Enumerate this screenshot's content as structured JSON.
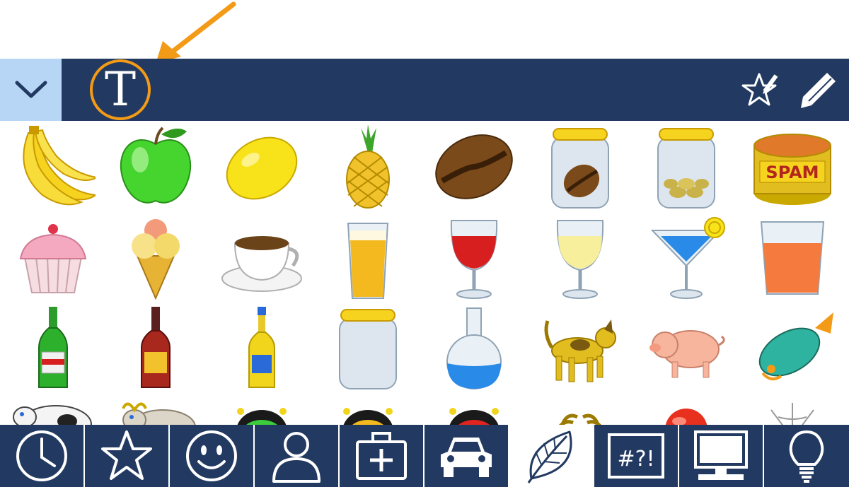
{
  "toolbar": {
    "collapse_icon": "chevron-down-icon",
    "text_button_glyph": "T",
    "favorite_edit_icon": "star-pencil-icon",
    "edit_icon": "pencil-icon",
    "colors": {
      "bar": "#223a61",
      "collapse_bg": "#b7d6f6",
      "highlight": "#f39a17"
    }
  },
  "symbols": [
    {
      "name": "banana-icon"
    },
    {
      "name": "green-apple-icon"
    },
    {
      "name": "lemon-icon"
    },
    {
      "name": "pineapple-icon"
    },
    {
      "name": "coffee-bean-icon"
    },
    {
      "name": "coffee-jar-icon"
    },
    {
      "name": "jar-of-nuts-icon"
    },
    {
      "name": "spam-can-icon",
      "label": "SPAM"
    },
    {
      "name": "cupcake-icon"
    },
    {
      "name": "ice-cream-cone-icon"
    },
    {
      "name": "coffee-cup-icon"
    },
    {
      "name": "beer-glass-icon"
    },
    {
      "name": "red-wine-glass-icon"
    },
    {
      "name": "white-wine-glass-icon"
    },
    {
      "name": "cocktail-glass-icon"
    },
    {
      "name": "juice-glass-icon"
    },
    {
      "name": "green-bottle-icon"
    },
    {
      "name": "wine-bottle-icon"
    },
    {
      "name": "yellow-bottle-icon"
    },
    {
      "name": "empty-jar-icon"
    },
    {
      "name": "flask-icon"
    },
    {
      "name": "dog-icon"
    },
    {
      "name": "pig-icon"
    },
    {
      "name": "fish-icon"
    },
    {
      "name": "cow-icon"
    },
    {
      "name": "bull-icon"
    },
    {
      "name": "green-bug-icon"
    },
    {
      "name": "bee-icon"
    },
    {
      "name": "ladybug-icon"
    },
    {
      "name": "spider-icon"
    },
    {
      "name": "red-ball-icon"
    },
    {
      "name": "web-icon"
    }
  ],
  "categories": [
    {
      "name": "recent-clock-icon"
    },
    {
      "name": "favorites-star-icon"
    },
    {
      "name": "smiley-icon"
    },
    {
      "name": "person-icon"
    },
    {
      "name": "first-aid-kit-icon"
    },
    {
      "name": "car-icon"
    },
    {
      "name": "leaf-icon",
      "active": true
    },
    {
      "name": "punctuation-icon",
      "label": "#?!"
    },
    {
      "name": "computer-icon"
    },
    {
      "name": "lightbulb-icon"
    }
  ]
}
